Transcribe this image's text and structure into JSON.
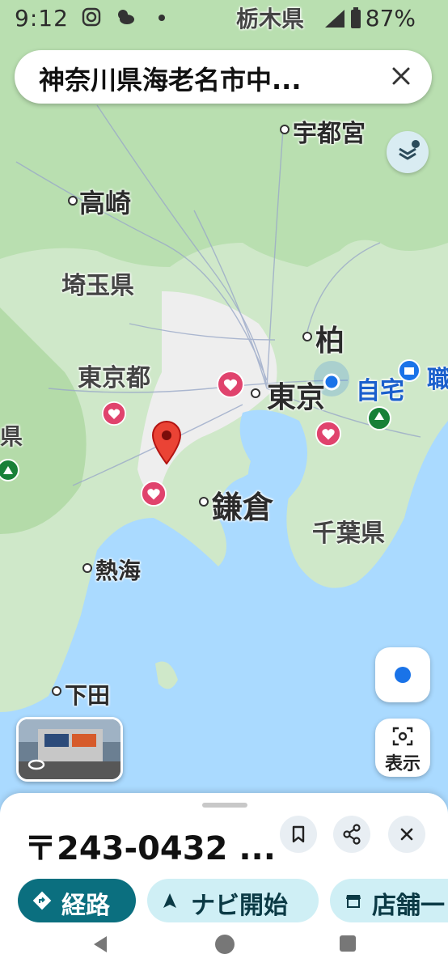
{
  "status_bar": {
    "time": "9:12",
    "battery": "87%"
  },
  "search": {
    "query": "神奈川県海老名市中...",
    "close_icon": "close-icon"
  },
  "map_labels": {
    "tochigi": "栃木県",
    "utsunomiya": "宇都宮",
    "takasaki": "高崎",
    "saitama": "埼玉県",
    "kashiwa": "柏",
    "tokyo_to": "東京都",
    "tokyo": "東京",
    "home": "自宅",
    "work": "職",
    "kamakura": "鎌倉",
    "chiba": "千葉県",
    "atami": "熱海",
    "shimoda": "下田",
    "yamanashi": "県"
  },
  "controls": {
    "lens_label": "表示"
  },
  "sheet": {
    "address": "〒243-0432 ...",
    "chips": [
      {
        "label": "経路",
        "icon": "directions-icon"
      },
      {
        "label": "ナビ開始",
        "icon": "navigation-arrow-icon"
      },
      {
        "label": "店舗一",
        "icon": "store-icon"
      }
    ]
  },
  "colors": {
    "accent": "#0b6f7f",
    "chip_bg": "#cfeff5",
    "pin": "#ea4335",
    "saved": "#e0436d",
    "water": "#aadaff"
  }
}
